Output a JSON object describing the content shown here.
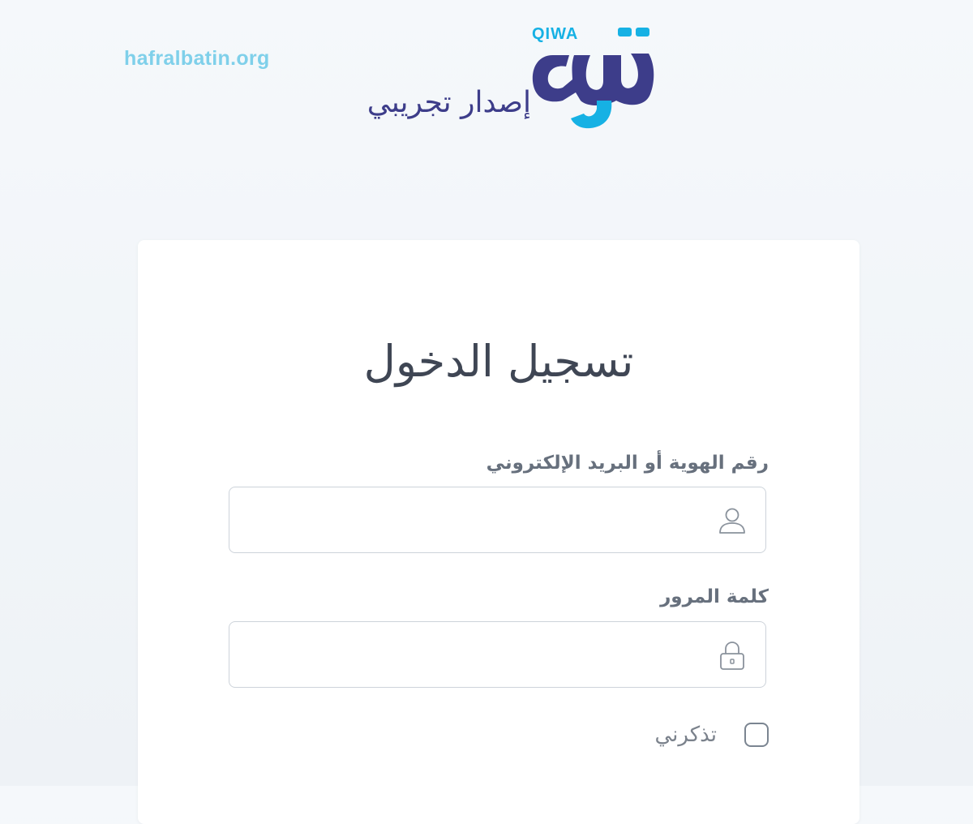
{
  "watermark": "hafralbatin.org",
  "logo": {
    "latin_text": "QIWA",
    "subtitle": "إصدار تجريبي",
    "colors": {
      "primary": "#3d3d8a",
      "accent": "#16b1e4"
    }
  },
  "login": {
    "title": "تسجيل الدخول",
    "id_field": {
      "label": "رقم الهوية أو البريد الإلكتروني",
      "value": "",
      "placeholder": "",
      "icon": "user-icon"
    },
    "password_field": {
      "label": "كلمة المرور",
      "value": "",
      "placeholder": "",
      "icon": "lock-icon"
    },
    "remember_me": {
      "label": "تذكرني",
      "checked": false
    }
  }
}
